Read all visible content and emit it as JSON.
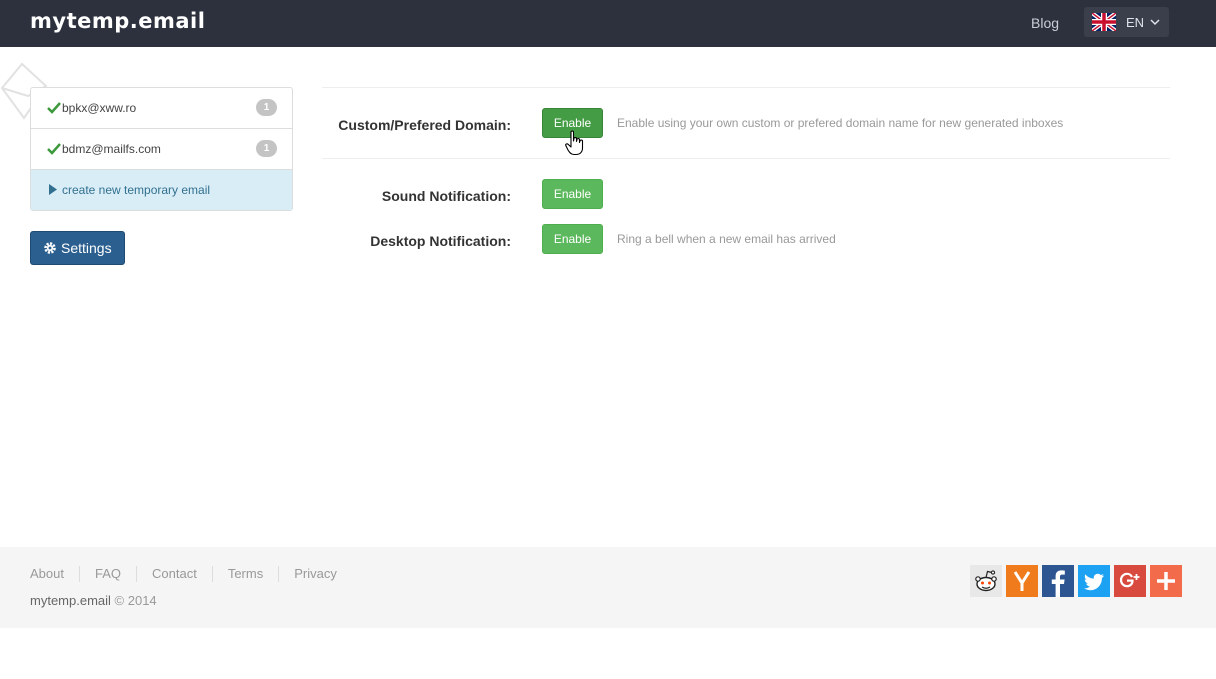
{
  "brand": "mytemp.email",
  "nav": {
    "blog": "Blog",
    "language": "EN"
  },
  "inboxes": [
    {
      "address": "bpkx@xww.ro",
      "count": "1"
    },
    {
      "address": "bdmz@mailfs.com",
      "count": "1"
    }
  ],
  "create_label": "create new temporary email",
  "settings_label": "Settings",
  "settings": [
    {
      "label": "Custom/Prefered Domain:",
      "button": "Enable",
      "help": "Enable using your own custom or prefered domain name for new generated inboxes"
    },
    {
      "label": "Sound Notification:",
      "button": "Enable",
      "help": ""
    },
    {
      "label": "Desktop Notification:",
      "button": "Enable",
      "help": "Ring a bell when a new email has arrived"
    }
  ],
  "footer": {
    "links": [
      "About",
      "FAQ",
      "Contact",
      "Terms",
      "Privacy"
    ],
    "site": "mytemp.email",
    "copyright": "© 2014"
  },
  "social_icons": [
    "reddit-icon",
    "hacker-news-icon",
    "facebook-icon",
    "twitter-icon",
    "google-plus-icon",
    "more-share-icon"
  ],
  "colors": {
    "navbar": "#2c313d",
    "enable": "#5cb85c",
    "settings": "#2b5f8f",
    "create_bg": "#d9edf7"
  }
}
